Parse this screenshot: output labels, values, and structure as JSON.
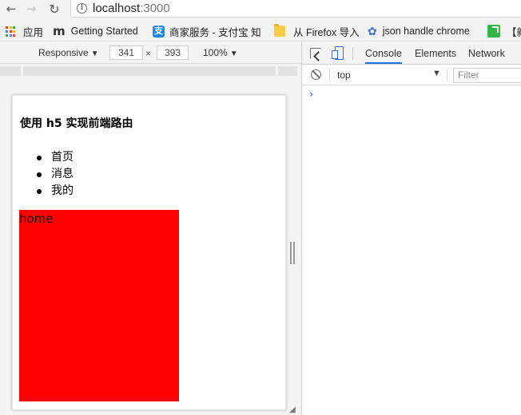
{
  "browser": {
    "url_host": "localhost",
    "url_port": ":3000"
  },
  "bookmarks": [
    {
      "icon": "apps-grid-icon",
      "label": "应用"
    },
    {
      "icon": "m-logo-icon",
      "label": "Getting Started"
    },
    {
      "icon": "alipay-icon",
      "label": "商家服务 - 支付宝 知"
    },
    {
      "icon": "folder-icon",
      "label": "从 Firefox 导入"
    },
    {
      "icon": "paw-icon",
      "label": "json handle chrome"
    },
    {
      "icon": "green-bookmark-icon",
      "label": "【新"
    }
  ],
  "device_toolbar": {
    "mode": "Responsive",
    "width": "341",
    "times": "×",
    "height": "393",
    "zoom": "100%"
  },
  "page": {
    "title": "使用 h5 实现前端路由",
    "nav_items": [
      "首页",
      "消息",
      "我的"
    ],
    "route_view_text": "home",
    "route_view_color": "#ff0000"
  },
  "devtools": {
    "tabs": [
      "Console",
      "Elements",
      "Network"
    ],
    "active_tab": "Console",
    "context": "top",
    "filter_placeholder": "Filter",
    "prompt": "›"
  },
  "colors": {
    "accent": "#1a73e8",
    "chrome_bg": "#f2f2f2"
  }
}
